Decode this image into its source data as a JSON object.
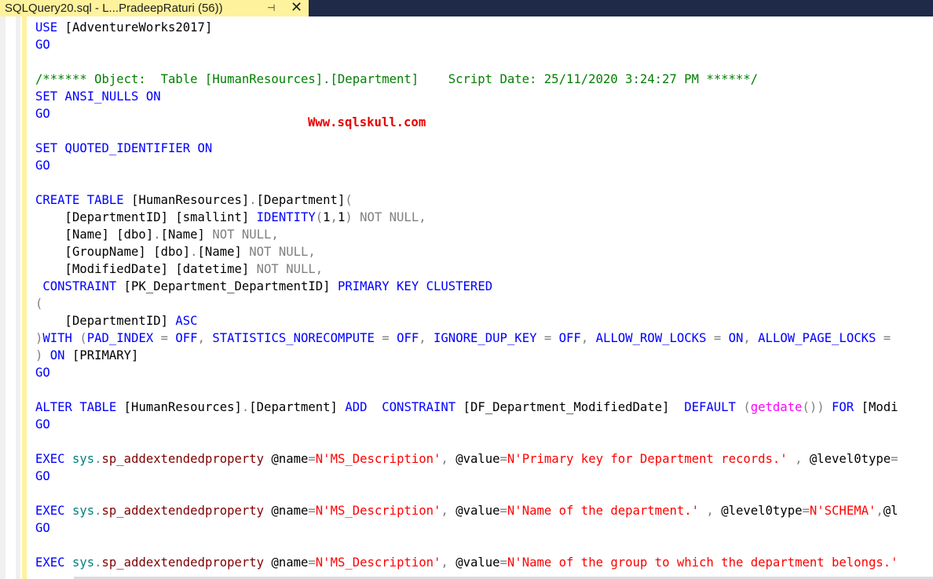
{
  "tab": {
    "title": "SQLQuery20.sql - L...PradeepRaturi (56))",
    "pin_glyph": "⊣",
    "close_glyph": "✕"
  },
  "watermark": "Www.sqlskull.com",
  "code_lines": [
    [
      {
        "c": "kw",
        "t": "USE "
      },
      {
        "c": "",
        "t": "[AdventureWorks2017]"
      }
    ],
    [
      {
        "c": "kw",
        "t": "GO"
      }
    ],
    [],
    [
      {
        "c": "cm",
        "t": "/****** Object:  Table [HumanResources].[Department]    Script Date: 25/11/2020 3:24:27 PM ******/"
      }
    ],
    [
      {
        "c": "kw",
        "t": "SET ANSI_NULLS ON"
      }
    ],
    [
      {
        "c": "kw",
        "t": "GO"
      }
    ],
    [],
    [
      {
        "c": "kw",
        "t": "SET QUOTED_IDENTIFIER ON"
      }
    ],
    [
      {
        "c": "kw",
        "t": "GO"
      }
    ],
    [],
    [
      {
        "c": "kw",
        "t": "CREATE TABLE "
      },
      {
        "c": "",
        "t": "[HumanResources]"
      },
      {
        "c": "gr",
        "t": "."
      },
      {
        "c": "",
        "t": "[Department]"
      },
      {
        "c": "gr",
        "t": "("
      }
    ],
    [
      {
        "c": "",
        "t": "    [DepartmentID] [smallint] "
      },
      {
        "c": "kw",
        "t": "IDENTITY"
      },
      {
        "c": "gr",
        "t": "("
      },
      {
        "c": "",
        "t": "1"
      },
      {
        "c": "gr",
        "t": ","
      },
      {
        "c": "",
        "t": "1"
      },
      {
        "c": "gr",
        "t": ") NOT NULL,"
      }
    ],
    [
      {
        "c": "",
        "t": "    [Name] [dbo]"
      },
      {
        "c": "gr",
        "t": "."
      },
      {
        "c": "",
        "t": "[Name] "
      },
      {
        "c": "gr",
        "t": "NOT NULL,"
      }
    ],
    [
      {
        "c": "",
        "t": "    [GroupName] [dbo]"
      },
      {
        "c": "gr",
        "t": "."
      },
      {
        "c": "",
        "t": "[Name] "
      },
      {
        "c": "gr",
        "t": "NOT NULL,"
      }
    ],
    [
      {
        "c": "",
        "t": "    [ModifiedDate] [datetime] "
      },
      {
        "c": "gr",
        "t": "NOT NULL,"
      }
    ],
    [
      {
        "c": "kw",
        "t": " CONSTRAINT "
      },
      {
        "c": "",
        "t": "[PK_Department_DepartmentID] "
      },
      {
        "c": "kw",
        "t": "PRIMARY KEY CLUSTERED"
      }
    ],
    [
      {
        "c": "gr",
        "t": "("
      }
    ],
    [
      {
        "c": "",
        "t": "    [DepartmentID] "
      },
      {
        "c": "kw",
        "t": "ASC"
      }
    ],
    [
      {
        "c": "gr",
        "t": ")"
      },
      {
        "c": "kw",
        "t": "WITH "
      },
      {
        "c": "gr",
        "t": "("
      },
      {
        "c": "kw",
        "t": "PAD_INDEX "
      },
      {
        "c": "gr",
        "t": "= "
      },
      {
        "c": "kw",
        "t": "OFF"
      },
      {
        "c": "gr",
        "t": ", "
      },
      {
        "c": "kw",
        "t": "STATISTICS_NORECOMPUTE "
      },
      {
        "c": "gr",
        "t": "= "
      },
      {
        "c": "kw",
        "t": "OFF"
      },
      {
        "c": "gr",
        "t": ", "
      },
      {
        "c": "kw",
        "t": "IGNORE_DUP_KEY "
      },
      {
        "c": "gr",
        "t": "= "
      },
      {
        "c": "kw",
        "t": "OFF"
      },
      {
        "c": "gr",
        "t": ", "
      },
      {
        "c": "kw",
        "t": "ALLOW_ROW_LOCKS "
      },
      {
        "c": "gr",
        "t": "= "
      },
      {
        "c": "kw",
        "t": "ON"
      },
      {
        "c": "gr",
        "t": ", "
      },
      {
        "c": "kw",
        "t": "ALLOW_PAGE_LOCKS "
      },
      {
        "c": "gr",
        "t": "="
      }
    ],
    [
      {
        "c": "gr",
        "t": ") "
      },
      {
        "c": "kw",
        "t": "ON "
      },
      {
        "c": "",
        "t": "[PRIMARY]"
      }
    ],
    [
      {
        "c": "kw",
        "t": "GO"
      }
    ],
    [],
    [
      {
        "c": "kw",
        "t": "ALTER TABLE "
      },
      {
        "c": "",
        "t": "[HumanResources]"
      },
      {
        "c": "gr",
        "t": "."
      },
      {
        "c": "",
        "t": "[Department] "
      },
      {
        "c": "kw",
        "t": "ADD  CONSTRAINT "
      },
      {
        "c": "",
        "t": "[DF_Department_ModifiedDate]  "
      },
      {
        "c": "kw",
        "t": "DEFAULT "
      },
      {
        "c": "gr",
        "t": "("
      },
      {
        "c": "fn",
        "t": "getdate"
      },
      {
        "c": "gr",
        "t": "()) "
      },
      {
        "c": "kw",
        "t": "FOR "
      },
      {
        "c": "",
        "t": "[Modi"
      }
    ],
    [
      {
        "c": "kw",
        "t": "GO"
      }
    ],
    [],
    [
      {
        "c": "kw",
        "t": "EXEC "
      },
      {
        "c": "sy",
        "t": "sys"
      },
      {
        "c": "gr",
        "t": "."
      },
      {
        "c": "sp",
        "t": "sp_addextendedproperty "
      },
      {
        "c": "",
        "t": "@name"
      },
      {
        "c": "gr",
        "t": "="
      },
      {
        "c": "st",
        "t": "N'MS_Description'"
      },
      {
        "c": "gr",
        "t": ", "
      },
      {
        "c": "",
        "t": "@value"
      },
      {
        "c": "gr",
        "t": "="
      },
      {
        "c": "st",
        "t": "N'Primary key for Department records.'"
      },
      {
        "c": "",
        "t": " "
      },
      {
        "c": "gr",
        "t": ", "
      },
      {
        "c": "",
        "t": "@level0type"
      },
      {
        "c": "gr",
        "t": "="
      }
    ],
    [
      {
        "c": "kw",
        "t": "GO"
      }
    ],
    [],
    [
      {
        "c": "kw",
        "t": "EXEC "
      },
      {
        "c": "sy",
        "t": "sys"
      },
      {
        "c": "gr",
        "t": "."
      },
      {
        "c": "sp",
        "t": "sp_addextendedproperty "
      },
      {
        "c": "",
        "t": "@name"
      },
      {
        "c": "gr",
        "t": "="
      },
      {
        "c": "st",
        "t": "N'MS_Description'"
      },
      {
        "c": "gr",
        "t": ", "
      },
      {
        "c": "",
        "t": "@value"
      },
      {
        "c": "gr",
        "t": "="
      },
      {
        "c": "st",
        "t": "N'Name of the department.'"
      },
      {
        "c": "",
        "t": " "
      },
      {
        "c": "gr",
        "t": ", "
      },
      {
        "c": "",
        "t": "@level0type"
      },
      {
        "c": "gr",
        "t": "="
      },
      {
        "c": "st",
        "t": "N'SCHEMA'"
      },
      {
        "c": "gr",
        "t": ","
      },
      {
        "c": "",
        "t": "@l"
      }
    ],
    [
      {
        "c": "kw",
        "t": "GO"
      }
    ],
    [],
    [
      {
        "c": "kw",
        "t": "EXEC "
      },
      {
        "c": "sy",
        "t": "sys"
      },
      {
        "c": "gr",
        "t": "."
      },
      {
        "c": "sp",
        "t": "sp_addextendedproperty "
      },
      {
        "c": "",
        "t": "@name"
      },
      {
        "c": "gr",
        "t": "="
      },
      {
        "c": "st",
        "t": "N'MS_Description'"
      },
      {
        "c": "gr",
        "t": ", "
      },
      {
        "c": "",
        "t": "@value"
      },
      {
        "c": "gr",
        "t": "="
      },
      {
        "c": "st",
        "t": "N'Name of the group to which the department belongs.'"
      }
    ]
  ]
}
